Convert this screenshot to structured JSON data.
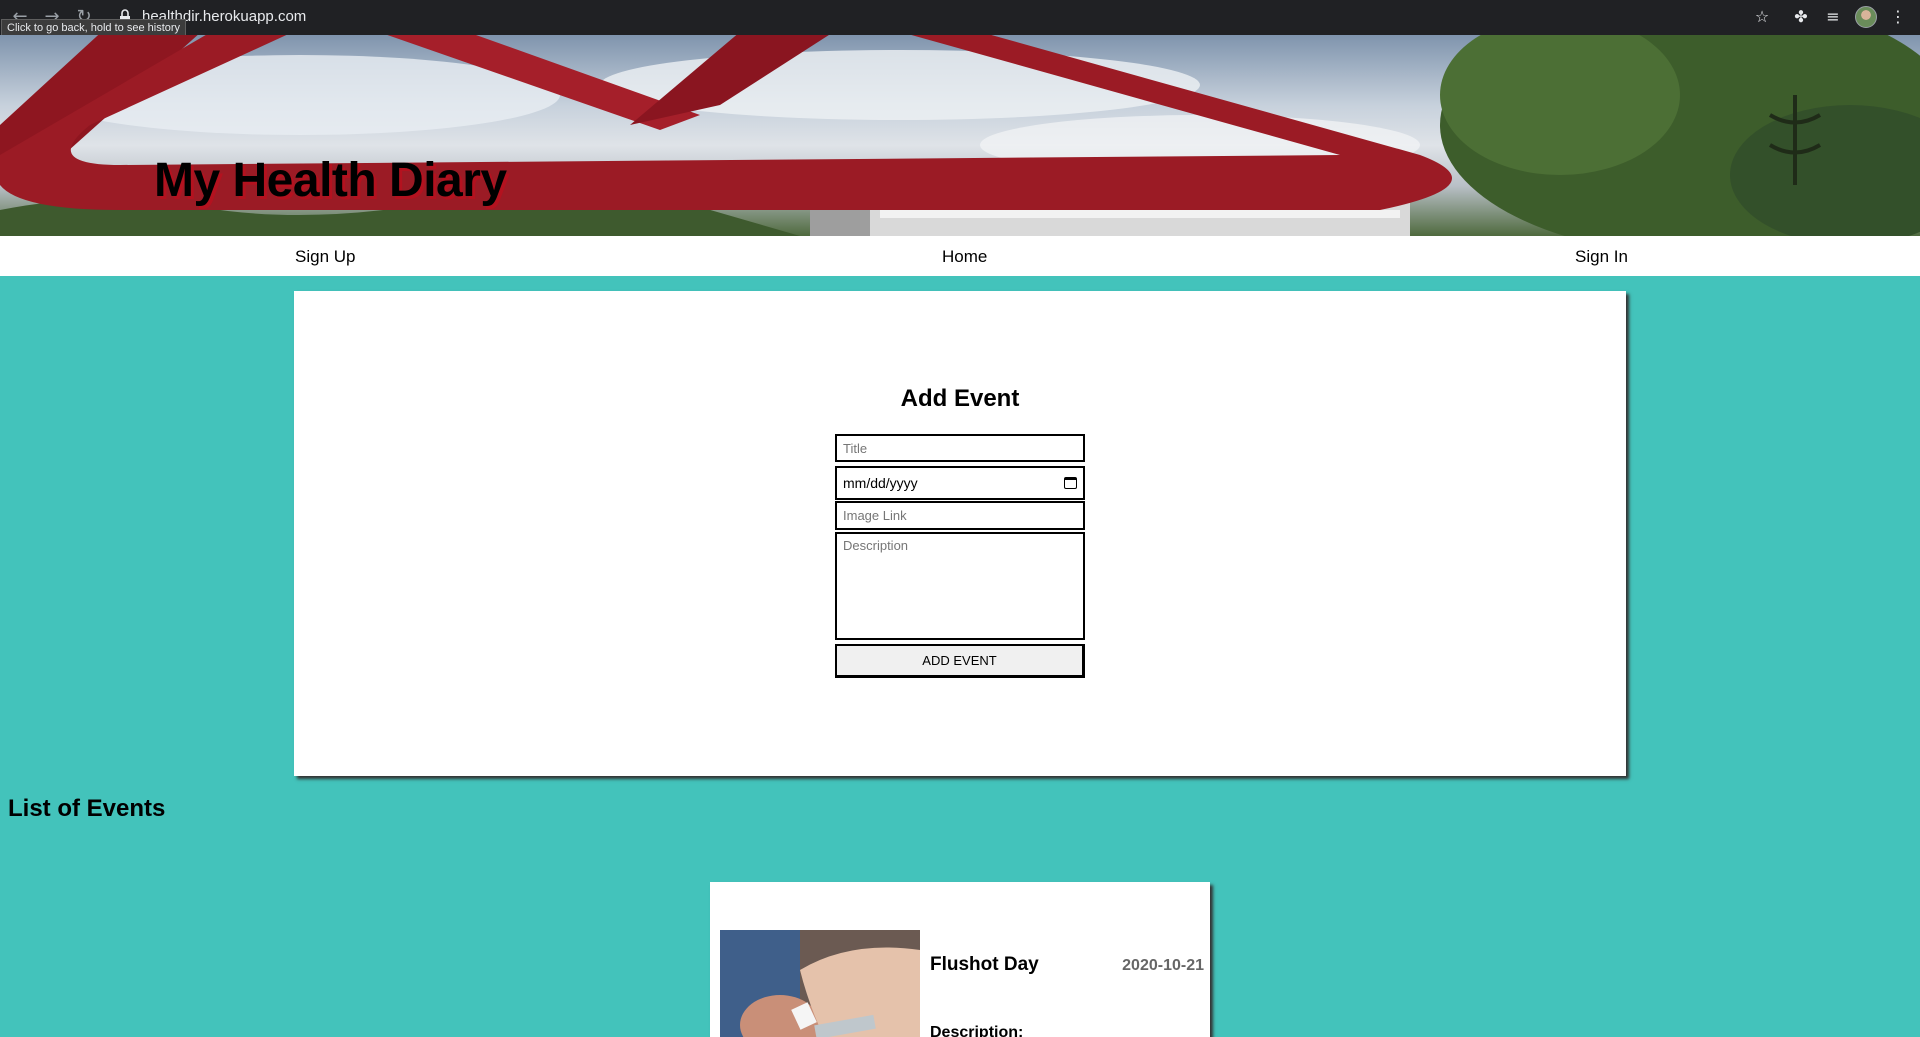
{
  "browser": {
    "url": "healthdir.herokuapp.com",
    "tooltip": "Click to go back, hold to see history"
  },
  "header": {
    "title": "My Health Diary"
  },
  "nav": {
    "sign_up": "Sign Up",
    "home": "Home",
    "sign_in": "Sign In"
  },
  "form": {
    "title": "Add Event",
    "title_placeholder": "Title",
    "date_placeholder": "mm/dd/yyyy",
    "image_placeholder": "Image Link",
    "description_placeholder": "Description",
    "submit_label": "ADD EVENT"
  },
  "events": {
    "heading": "List of Events",
    "items": [
      {
        "title": "Flushot Day",
        "date": "2020-10-21",
        "description_label": "Description:"
      }
    ]
  },
  "colors": {
    "page_background": "#43c3bb",
    "title_shadow": "#b3121f"
  }
}
